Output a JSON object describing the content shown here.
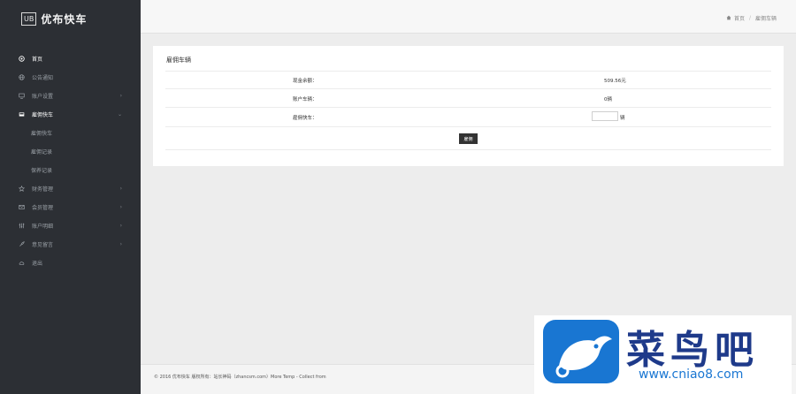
{
  "brand": {
    "badge": "UB",
    "name": "优布快车"
  },
  "sidebar": {
    "items": [
      {
        "label": "首页",
        "icon": "home-icon",
        "has_arrow": false,
        "active": true
      },
      {
        "label": "公告通知",
        "icon": "globe-icon",
        "has_arrow": false,
        "active": false
      },
      {
        "label": "账户设置",
        "icon": "monitor-icon",
        "has_arrow": true,
        "active": false
      },
      {
        "label": "雇佣快车",
        "icon": "inbox-icon",
        "has_arrow": true,
        "active": true
      }
    ],
    "subitems": [
      "雇佣快车",
      "雇佣记录",
      "保养记录"
    ],
    "items2": [
      {
        "label": "财务管理",
        "icon": "star-icon",
        "has_arrow": true
      },
      {
        "label": "会员管理",
        "icon": "envelope-icon",
        "has_arrow": true
      },
      {
        "label": "账户明细",
        "icon": "sliders-icon",
        "has_arrow": true
      },
      {
        "label": "意见留言",
        "icon": "rocket-icon",
        "has_arrow": true
      },
      {
        "label": "退出",
        "icon": "cloud-icon",
        "has_arrow": false
      }
    ]
  },
  "breadcrumb": {
    "home": "首页",
    "separator": "/",
    "current": "雇佣车辆"
  },
  "panel": {
    "title": "雇佣车辆",
    "rows": [
      {
        "label": "现金余额：",
        "value": "509.56元"
      },
      {
        "label": "账户车辆：",
        "value": "0辆"
      },
      {
        "label": "雇佣快车：",
        "value": "",
        "unit": "辆"
      }
    ],
    "submit_label": "雇佣"
  },
  "footer": {
    "text": "© 2016 优布快车 版权所有：站长神码（zhancsm.com）More Temp - Collect from"
  },
  "watermark": {
    "title": "菜鸟吧",
    "url": "www.cniao8.com"
  }
}
